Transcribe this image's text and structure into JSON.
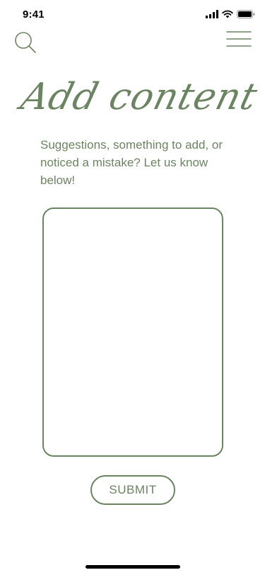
{
  "status_bar": {
    "time": "9:41",
    "icons": [
      "cellular-signal-icon",
      "wifi-icon",
      "battery-icon"
    ]
  },
  "nav": {
    "search_icon": "search-icon",
    "menu_icon": "hamburger-menu-icon"
  },
  "page": {
    "title": "Add content",
    "intro": "Suggestions, something to add, or noticed a mistake? Let us know below!"
  },
  "form": {
    "textarea_value": "",
    "submit_label": "SUBMIT"
  },
  "colors": {
    "accent": "#6b8461",
    "background": "#ffffff",
    "status_text": "#000000"
  }
}
